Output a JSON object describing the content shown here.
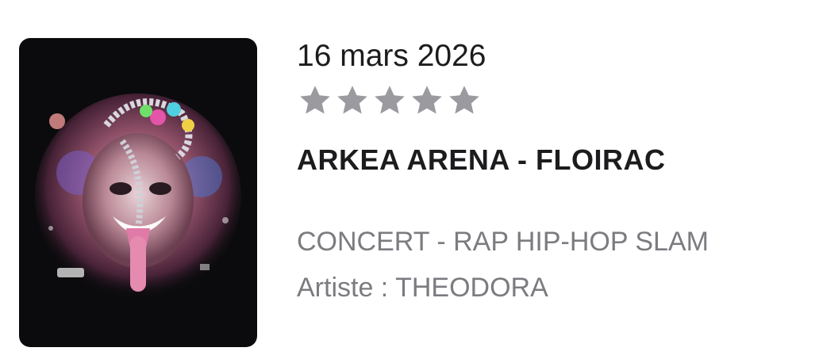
{
  "event": {
    "date": "16 mars 2026",
    "rating": {
      "value": 0,
      "max": 5,
      "icon": "star-icon",
      "empty_color": "#9a9a9f"
    },
    "venue": "ARKEA ARENA - FLOIRAC",
    "category": "CONCERT - RAP HIP-HOP SLAM",
    "artist_line": "Artiste : THEODORA",
    "image": {
      "icon": "artist-artwork-image",
      "background": "#0b0b0d"
    }
  }
}
